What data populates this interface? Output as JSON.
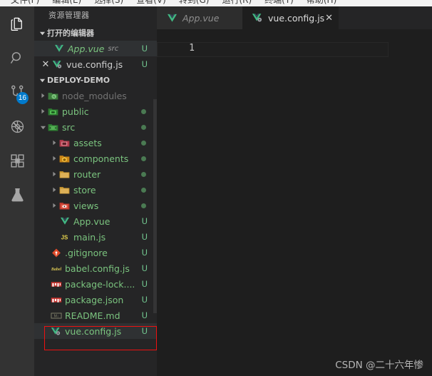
{
  "menubar": {
    "items": [
      "文件(F)",
      "编辑(E)",
      "选择(S)",
      "查看(V)",
      "转到(G)",
      "运行(R)",
      "终端(T)",
      "帮助(H)"
    ]
  },
  "activitybar": {
    "items": [
      {
        "name": "explorer",
        "icon": "files-icon",
        "badge": ""
      },
      {
        "name": "search",
        "icon": "search-icon",
        "badge": ""
      },
      {
        "name": "source-control",
        "icon": "source-control-icon",
        "badge": "16"
      },
      {
        "name": "run-debug",
        "icon": "run-debug-icon",
        "badge": ""
      },
      {
        "name": "extensions",
        "icon": "extensions-icon",
        "badge": ""
      },
      {
        "name": "testing",
        "icon": "flask-icon",
        "badge": ""
      }
    ]
  },
  "sidebar": {
    "title": "资源管理器",
    "open_editors": {
      "header": "打开的编辑器",
      "items": [
        {
          "label": "App.vue",
          "sub": "src",
          "status": "U",
          "icon": "vue-icon",
          "active": true,
          "close": ""
        },
        {
          "label": "vue.config.js",
          "sub": "",
          "status": "U",
          "icon": "vue-config-icon",
          "active": false,
          "close": "✕"
        }
      ]
    },
    "project": {
      "header": "DEPLOY-DEMO",
      "tree": [
        {
          "label": "node_modules",
          "depth": 0,
          "type": "folder",
          "expanded": false,
          "icon": "folder-node-modules-icon",
          "status": "",
          "dot": false,
          "dim": true
        },
        {
          "label": "public",
          "depth": 0,
          "type": "folder",
          "expanded": false,
          "icon": "folder-public-icon",
          "status": "",
          "dot": true,
          "dim": false
        },
        {
          "label": "src",
          "depth": 0,
          "type": "folder",
          "expanded": true,
          "icon": "folder-src-icon",
          "status": "",
          "dot": true,
          "dim": false
        },
        {
          "label": "assets",
          "depth": 1,
          "type": "folder",
          "expanded": false,
          "icon": "folder-assets-icon",
          "status": "",
          "dot": true,
          "dim": false
        },
        {
          "label": "components",
          "depth": 1,
          "type": "folder",
          "expanded": false,
          "icon": "folder-components-icon",
          "status": "",
          "dot": true,
          "dim": false
        },
        {
          "label": "router",
          "depth": 1,
          "type": "folder",
          "expanded": false,
          "icon": "folder-router-icon",
          "status": "",
          "dot": true,
          "dim": false
        },
        {
          "label": "store",
          "depth": 1,
          "type": "folder",
          "expanded": false,
          "icon": "folder-store-icon",
          "status": "",
          "dot": true,
          "dim": false
        },
        {
          "label": "views",
          "depth": 1,
          "type": "folder",
          "expanded": false,
          "icon": "folder-views-icon",
          "status": "",
          "dot": true,
          "dim": false
        },
        {
          "label": "App.vue",
          "depth": 1,
          "type": "file",
          "expanded": false,
          "icon": "vue-icon",
          "status": "U",
          "dot": false,
          "dim": false
        },
        {
          "label": "main.js",
          "depth": 1,
          "type": "file",
          "expanded": false,
          "icon": "js-icon",
          "status": "U",
          "dot": false,
          "dim": false
        },
        {
          "label": ".gitignore",
          "depth": 0,
          "type": "file",
          "expanded": false,
          "icon": "git-icon",
          "status": "U",
          "dot": false,
          "dim": false
        },
        {
          "label": "babel.config.js",
          "depth": 0,
          "type": "file",
          "expanded": false,
          "icon": "babel-icon",
          "status": "U",
          "dot": false,
          "dim": false
        },
        {
          "label": "package-lock....",
          "depth": 0,
          "type": "file",
          "expanded": false,
          "icon": "npm-icon",
          "status": "U",
          "dot": false,
          "dim": false
        },
        {
          "label": "package.json",
          "depth": 0,
          "type": "file",
          "expanded": false,
          "icon": "npm-icon",
          "status": "U",
          "dot": false,
          "dim": false
        },
        {
          "label": "README.md",
          "depth": 0,
          "type": "file",
          "expanded": false,
          "icon": "markdown-icon",
          "status": "U",
          "dot": false,
          "dim": false
        },
        {
          "label": "vue.config.js",
          "depth": 0,
          "type": "file",
          "expanded": false,
          "icon": "vue-config-icon",
          "status": "U",
          "dot": false,
          "dim": false,
          "selected": true
        }
      ]
    }
  },
  "editor": {
    "tabs": [
      {
        "label": "App.vue",
        "icon": "vue-icon",
        "active": false,
        "close": ""
      },
      {
        "label": "vue.config.js",
        "icon": "vue-config-icon",
        "active": true,
        "close": "✕"
      }
    ],
    "line_numbers": [
      "1"
    ]
  },
  "watermark": "CSDN @二十六年惨",
  "colors": {
    "accent_blue": "#007acc",
    "vue_green": "#41b883",
    "file_green": "#7bc47f",
    "annotation_red": "#ee1111",
    "badge_u": "#73c991",
    "sidebar_bg": "#252526",
    "editor_bg": "#1e1e1e",
    "activitybar_bg": "#333333"
  }
}
